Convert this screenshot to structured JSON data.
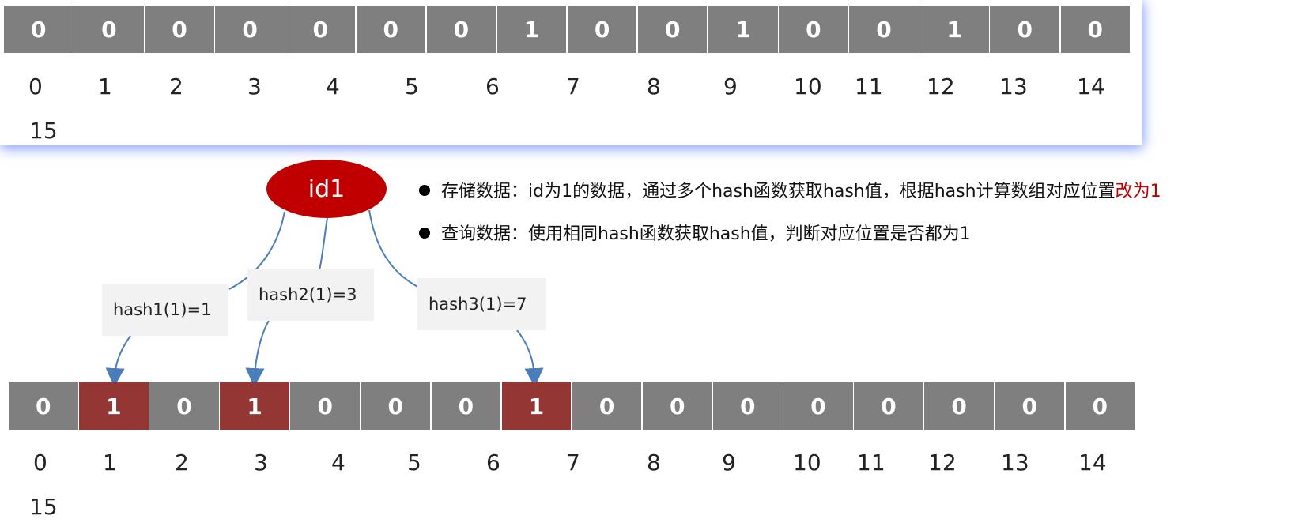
{
  "top_array": {
    "bits": [
      "0",
      "0",
      "0",
      "0",
      "0",
      "0",
      "0",
      "1",
      "0",
      "0",
      "1",
      "0",
      "0",
      "1",
      "0",
      "0"
    ],
    "indices": [
      "0",
      "1",
      "2",
      "3",
      "4",
      "5",
      "6",
      "7",
      "8",
      "9",
      "10",
      "11",
      "12",
      "13",
      "14",
      "15"
    ]
  },
  "node": {
    "label": "id1"
  },
  "hash_labels": [
    "hash1(1)=1",
    "hash2(1)=3",
    "hash3(1)=7"
  ],
  "bullets": {
    "store_prefix": "存储数据：id为1的数据，通过多个hash函数获取hash值，根据hash计算数组对应位置",
    "store_highlight": "改为1",
    "query": "查询数据：使用相同hash函数获取hash值，判断对应位置是否都为1"
  },
  "bottom_array": {
    "bits": [
      "0",
      "1",
      "0",
      "1",
      "0",
      "0",
      "0",
      "1",
      "0",
      "0",
      "0",
      "0",
      "0",
      "0",
      "0",
      "0"
    ],
    "highlighted_indices": [
      1,
      3,
      7
    ],
    "indices": [
      "0",
      "1",
      "2",
      "3",
      "4",
      "5",
      "6",
      "7",
      "8",
      "9",
      "10",
      "11",
      "12",
      "13",
      "14",
      "15"
    ]
  },
  "colors": {
    "cell": "#7f7f7f",
    "cell_highlight": "#943634",
    "node": "#c00000",
    "arrow": "#4a7ebb",
    "highlight_text": "#c00000"
  }
}
